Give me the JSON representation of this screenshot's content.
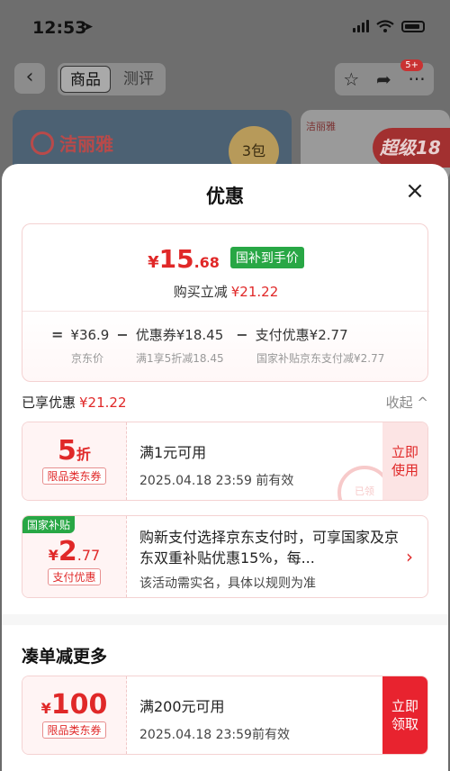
{
  "status": {
    "time": "12:53"
  },
  "nav": {
    "back_icon": "chevron-left-icon",
    "tabs": [
      "商品",
      "测评"
    ],
    "badge": "5+"
  },
  "promo": {
    "brand": "洁丽雅",
    "pack": "3包",
    "brand_small": "洁丽雅",
    "super": "超级18"
  },
  "sheet": {
    "title": "优惠",
    "summary": {
      "yen": "¥",
      "price_int": "15",
      "price_dec": ".68",
      "gov_tag": "国补到手价",
      "reduce_label": "购买立减",
      "reduce_value": "¥21.22",
      "calc": {
        "eq": "=",
        "jd_price": "¥36.9",
        "jd_label": "京东价",
        "minus1": "−",
        "coupon_text": "优惠券¥18.45",
        "coupon_sub": "满1享5折减18.45",
        "minus2": "−",
        "pay_text": "支付优惠¥2.77",
        "pay_sub": "国家补贴京东支付减¥2.77"
      }
    },
    "enjoyed_label": "已享优惠",
    "enjoyed_value": "¥21.22",
    "collapse_label": "收起 ^",
    "coupons": [
      {
        "main": "5",
        "unit": "折",
        "tag": "限品类东券",
        "title": "满1元可用",
        "sub": "2025.04.18 23:59 前有效",
        "btn_line1": "立即",
        "btn_line2": "使用",
        "stamp": "已领"
      },
      {
        "corner": "国家补贴",
        "yen": "¥",
        "main": "2",
        "dec": ".77",
        "tag": "支付优惠",
        "title": "购新支付选择京东支付时，可享国家及京东双重补贴优惠15%，每...",
        "sub": "该活动需实名，具体以规则为准"
      }
    ],
    "section2_title": "凑单减更多",
    "coupon3": {
      "yen": "¥",
      "main": "100",
      "tag": "限品类东券",
      "title": "满200元可用",
      "sub": "2025.04.18 23:59前有效",
      "btn_line1": "立即",
      "btn_line2": "领取"
    }
  }
}
